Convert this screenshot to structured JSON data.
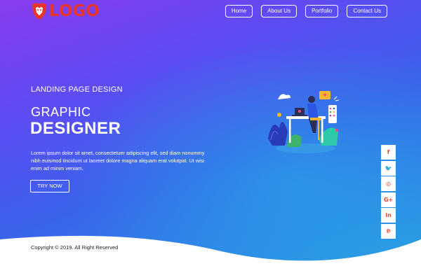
{
  "brand": {
    "logo_text": "LOGO"
  },
  "nav": {
    "items": [
      {
        "label": "Home"
      },
      {
        "label": "About Us"
      },
      {
        "label": "Portfolio"
      },
      {
        "label": "Contact Us"
      }
    ]
  },
  "hero": {
    "kicker": "LANDING PAGE DESIGN",
    "title_line1": "GRAPHIC",
    "title_line2": "DESIGNER",
    "description": "Lorem ipsum dolor sit amet, consectetuer adipiscing elit, sed diam nonummy nibh euismod tincidunt ut laoreet dolore magna aliquam erat volutpat. Ut wisi enim ad minim veniam.",
    "cta_label": "TRY NOW"
  },
  "social": {
    "items": [
      {
        "icon": "facebook-icon",
        "glyph": "f"
      },
      {
        "icon": "twitter-icon",
        "glyph": "🐦"
      },
      {
        "icon": "instagram-icon",
        "glyph": "◎"
      },
      {
        "icon": "google-plus-icon",
        "glyph": "G+"
      },
      {
        "icon": "linkedin-icon",
        "glyph": "in"
      },
      {
        "icon": "pinterest-icon",
        "glyph": "℗"
      }
    ]
  },
  "footer": {
    "copyright": "Copyright © 2019. All Right Reserved"
  },
  "colors": {
    "brand_red": "#e7352b",
    "gradient_start": "#8a3cf0",
    "gradient_end": "#2aa0e2"
  }
}
